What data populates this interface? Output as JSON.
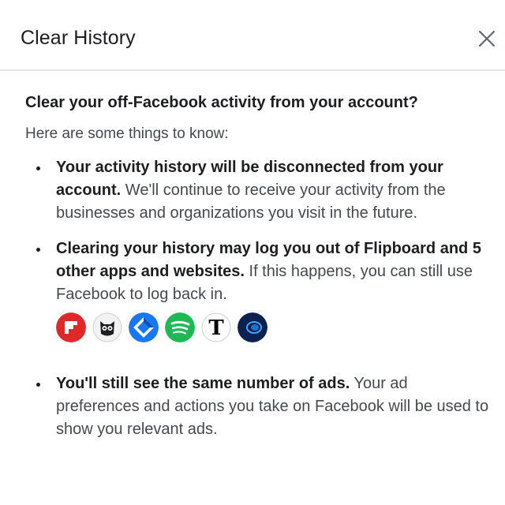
{
  "dialog": {
    "title": "Clear History",
    "close_icon": "close-icon"
  },
  "body": {
    "question": "Clear your off-Facebook activity from your account?",
    "intro": "Here are some things to know:",
    "points": [
      {
        "bold": "Your activity history will be disconnected from your account.",
        "text": " We'll continue to receive your activity from the businesses and organizations you visit in the future."
      },
      {
        "bold": "Clearing your history may log you out of Flipboard and 5 other apps and websites.",
        "text": " If this happens, you can still use Facebook to log back in."
      },
      {
        "bold": "You'll still see the same number of ads.",
        "text": " Your ad preferences and actions you take on Facebook will be used to show you relevant ads."
      }
    ],
    "app_icons": [
      {
        "name": "flipboard-icon",
        "color": "#e12828"
      },
      {
        "name": "owl-app-icon",
        "color": "#1c1e21"
      },
      {
        "name": "diamond-app-icon",
        "color": "#1877f2"
      },
      {
        "name": "spotify-icon",
        "color": "#1db954"
      },
      {
        "name": "nytimes-icon",
        "color": "#000000"
      },
      {
        "name": "dark-blue-app-icon",
        "color": "#0b2150"
      }
    ]
  }
}
